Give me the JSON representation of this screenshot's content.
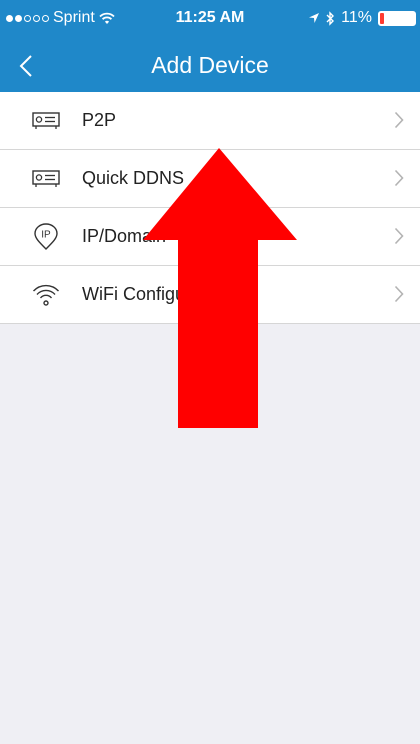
{
  "status_bar": {
    "carrier": "Sprint",
    "time": "11:25 AM",
    "battery": "11%",
    "battery_level": 0.11
  },
  "nav": {
    "title": "Add Device",
    "back_icon": "chevron-left-icon"
  },
  "menu": {
    "items": [
      {
        "label": "P2P",
        "icon": "dvr-icon"
      },
      {
        "label": "Quick DDNS",
        "icon": "dvr-icon"
      },
      {
        "label": "IP/Domain",
        "icon": "ip-pin-icon"
      },
      {
        "label": "WiFi Configuration",
        "icon": "wifi-icon"
      }
    ]
  },
  "colors": {
    "header": "#1f88c9",
    "background": "#efeff4",
    "annotation_arrow": "#ff0000"
  }
}
